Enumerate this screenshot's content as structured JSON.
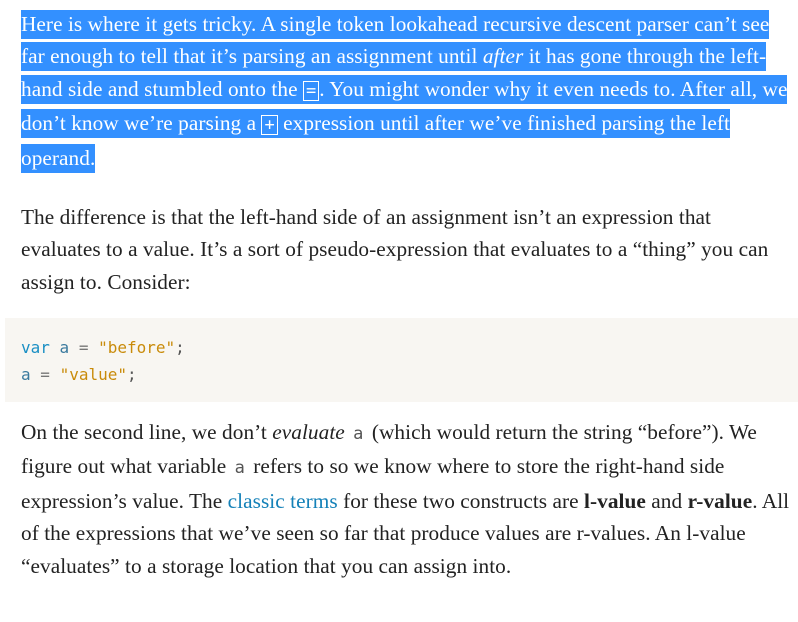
{
  "para1": {
    "t1": "Here is where it gets tricky. A single token lookahead recursive descent parser can’t see far enough to tell that it’s parsing an assignment until ",
    "em1": "after",
    "t2": " it has gone through the left-hand side and stumbled onto the ",
    "code1": "=",
    "t3": ". You might wonder why it even needs to. After all, we don’t know we’re parsing a ",
    "code2": "+",
    "t4": " expression until after we’ve finished parsing the left operand."
  },
  "para2": {
    "text": "The difference is that the left-hand side of an assignment isn’t an expression that evaluates to a value. It’s a sort of pseudo-expression that evaluates to a “thing” you can assign to. Consider:"
  },
  "code": {
    "line1": {
      "kw": "var",
      "ident": "a",
      "op": "=",
      "str": "\"before\"",
      "punct": ";"
    },
    "line2": {
      "ident": "a",
      "op": "=",
      "str": "\"value\"",
      "punct": ";"
    }
  },
  "para3": {
    "t1": "On the second line, we don’t ",
    "em1": "evaluate",
    "code1": "a",
    "t2": " (which would return the string “before”). We figure out what variable ",
    "code2": "a",
    "t3": " refers to so we know where to store the right-hand side expression’s value. The ",
    "link": "classic terms",
    "t4": " for these two constructs are ",
    "strong1": "l-value",
    "t5": " and ",
    "strong2": "r-value",
    "t6": ". All of the expressions that we’ve seen so far that produce values are r-values. An l-value “evaluates” to a storage location that you can assign into."
  },
  "colors": {
    "selection": "#3390ff",
    "link": "#1481b8",
    "code_keyword": "#1a8fc4",
    "code_string": "#c98b0a",
    "code_background": "#f8f6f2"
  }
}
